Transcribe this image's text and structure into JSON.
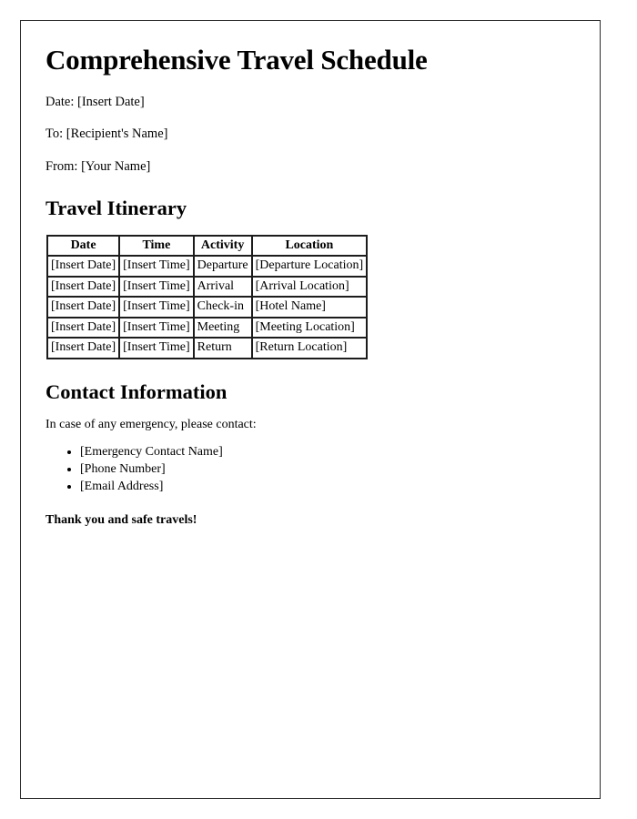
{
  "document": {
    "title": "Comprehensive Travel Schedule",
    "meta": {
      "date_line": "Date: [Insert Date]",
      "to_line": "To: [Recipient's Name]",
      "from_line": "From: [Your Name]"
    },
    "itinerary_section": {
      "heading": "Travel Itinerary",
      "table": {
        "columns": [
          "Date",
          "Time",
          "Activity",
          "Location"
        ],
        "rows": [
          [
            "[Insert Date]",
            "[Insert Time]",
            "Departure",
            "[Departure Location]"
          ],
          [
            "[Insert Date]",
            "[Insert Time]",
            "Arrival",
            "[Arrival Location]"
          ],
          [
            "[Insert Date]",
            "[Insert Time]",
            "Check-in",
            "[Hotel Name]"
          ],
          [
            "[Insert Date]",
            "[Insert Time]",
            "Meeting",
            "[Meeting Location]"
          ],
          [
            "[Insert Date]",
            "[Insert Time]",
            "Return",
            "[Return Location]"
          ]
        ]
      }
    },
    "contact_section": {
      "heading": "Contact Information",
      "intro": "In case of any emergency, please contact:",
      "items": [
        "[Emergency Contact Name]",
        "[Phone Number]",
        "[Email Address]"
      ],
      "closing": "Thank you and safe travels!"
    }
  }
}
